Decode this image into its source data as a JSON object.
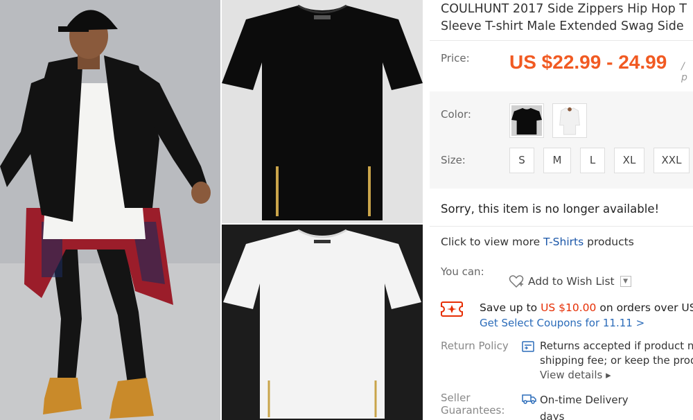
{
  "product": {
    "title_line1": "COULHUNT 2017 Side Zippers Hip Hop T",
    "title_line2": "Sleeve T-shirt Male Extended Swag Side"
  },
  "price": {
    "label": "Price:",
    "value": "US $22.99 - 24.99",
    "unit": "/ p"
  },
  "color": {
    "label": "Color:",
    "options": [
      "black",
      "white"
    ]
  },
  "size": {
    "label": "Size:",
    "options": [
      "S",
      "M",
      "L",
      "XL",
      "XXL"
    ]
  },
  "availability": "Sorry, this item is no longer available!",
  "more_products": {
    "prefix": "Click to view more ",
    "link": "T-Shirts",
    "suffix": " products"
  },
  "actions": {
    "label": "You can:",
    "wishlist": "Add to Wish List"
  },
  "coupon": {
    "text_before": "Save up to ",
    "amount": "US $10.00",
    "text_after": " on orders over US $",
    "link": "Get Select Coupons for 11.11 >"
  },
  "return_policy": {
    "label": "Return Policy",
    "line1": "Returns accepted if product n",
    "line2": "shipping fee; or keep the prod",
    "view_details": "View details ▸"
  },
  "seller_guarantees": {
    "label_line1": "Seller",
    "label_line2": "Guarantees:",
    "line1": "On-time Delivery",
    "line2": "days"
  },
  "colors": {
    "price_orange": "#f15a22",
    "link_blue": "#1a56a8",
    "coupon_red": "#e62e04"
  }
}
